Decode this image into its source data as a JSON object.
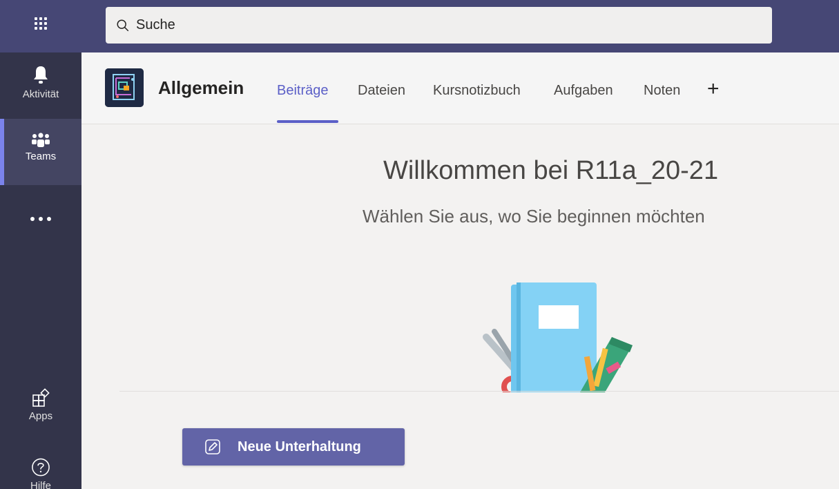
{
  "app": {
    "search_placeholder": "Suche"
  },
  "rail": {
    "items": [
      {
        "label": "Aktivität",
        "icon": "bell-icon"
      },
      {
        "label": "Teams",
        "icon": "teams-icon"
      },
      {
        "label": "",
        "icon": "more-icon"
      },
      {
        "label": "Apps",
        "icon": "apps-icon"
      },
      {
        "label": "Hilfe",
        "icon": "help-icon"
      }
    ]
  },
  "channel": {
    "name": "Allgemein",
    "tabs": [
      {
        "label": "Beiträge",
        "active": true
      },
      {
        "label": "Dateien"
      },
      {
        "label": "Kursnotizbuch"
      },
      {
        "label": "Aufgaben"
      },
      {
        "label": "Noten"
      }
    ],
    "add_tab": "+"
  },
  "welcome": {
    "title": "Willkommen bei R11a_20-21",
    "subtitle": "Wählen Sie aus, wo Sie beginnen möchten"
  },
  "compose": {
    "new_conversation_label": "Neue Unterhaltung"
  },
  "colors": {
    "header_bar": "#464775",
    "rail": "#33344a",
    "accent": "#6264a7",
    "tab_active": "#5b5fc7"
  }
}
